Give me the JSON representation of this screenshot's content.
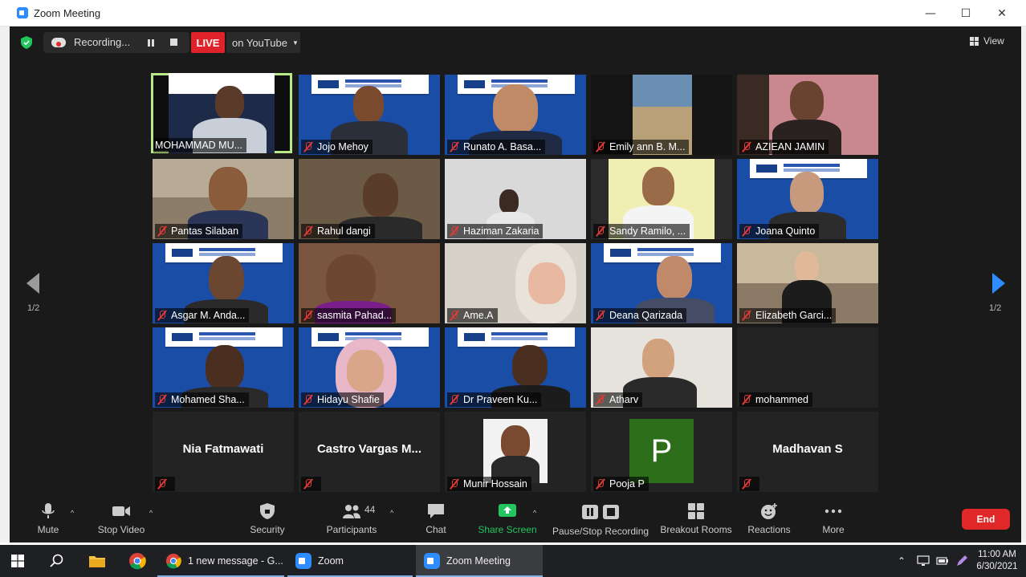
{
  "window": {
    "title": "Zoom Meeting",
    "minimize": "—",
    "maximize": "☐",
    "close": "✕"
  },
  "topbar": {
    "recording_label": "Recording...",
    "live_label": "LIVE",
    "stream_target": "on YouTube",
    "view_label": "View"
  },
  "pagination": {
    "left": "1/2",
    "right": "1/2"
  },
  "participants": [
    "MOHAMMAD MU...",
    "Jojo Mehoy",
    "Runato A. Basa...",
    "Emily ann B. M...",
    "AZIEAN JAMIN",
    "Pantas Silaban",
    "Rahul dangi",
    "Haziman Zakaria",
    "Sandy Ramilo, ...",
    "Joana Quinto",
    "Asgar M. Anda...",
    "sasmita Pahad...",
    "Ame.A",
    "Deana Qarizada",
    "Elizabeth Garci...",
    "Mohamed Sha...",
    "Hidayu Shafie",
    "Dr Praveen Ku...",
    "Atharv",
    "mohammed",
    "",
    "",
    "Munir Hossain",
    "Pooja P",
    ""
  ],
  "video_off_names": {
    "nia": "Nia Fatmawati",
    "castro": "Castro Vargas M...",
    "madhavan": "Madhavan S"
  },
  "avatar_letter": "P",
  "toolbar": {
    "mute": "Mute",
    "stop_video": "Stop Video",
    "security": "Security",
    "participants": "Participants",
    "participants_count": "44",
    "chat": "Chat",
    "share_screen": "Share Screen",
    "pause_stop_recording": "Pause/Stop Recording",
    "breakout_rooms": "Breakout Rooms",
    "reactions": "Reactions",
    "more": "More",
    "end": "End"
  },
  "taskbar": {
    "chrome_window": "1 new message - G...",
    "zoom": "Zoom",
    "zoom_meeting": "Zoom Meeting",
    "time": "11:00 AM",
    "date": "6/30/2021"
  },
  "colors": {
    "accent": "#2d8cff",
    "live": "#e0232a",
    "end": "#e02828",
    "active_speaker": "#b8e986",
    "share": "#22c55e"
  }
}
